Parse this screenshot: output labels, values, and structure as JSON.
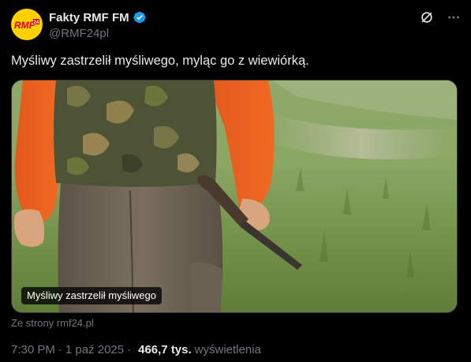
{
  "author": {
    "display_name": "Fakty RMF FM",
    "handle": "@RMF24pl",
    "avatar_text": "RMF24",
    "verified": true
  },
  "post": {
    "text": "Myśliwy zastrzelił myśliwego, myląc go z wiewiórką."
  },
  "media": {
    "caption": "Myśliwy zastrzelił myśliwego",
    "source": "Ze strony rmf24.pl"
  },
  "meta": {
    "time": "7:30 PM",
    "separator": "·",
    "date": "1 paź 2025",
    "views_count": "466,7 tys.",
    "views_label": "wyświetlenia"
  },
  "colors": {
    "background": "#000000",
    "text": "#e7e9ea",
    "secondary": "#71767b",
    "verified": "#1d9bf0",
    "avatar_bg": "#fdd100"
  },
  "icons": {
    "verified": "verified-badge-icon",
    "grok": "grok-icon",
    "more": "more-icon"
  }
}
